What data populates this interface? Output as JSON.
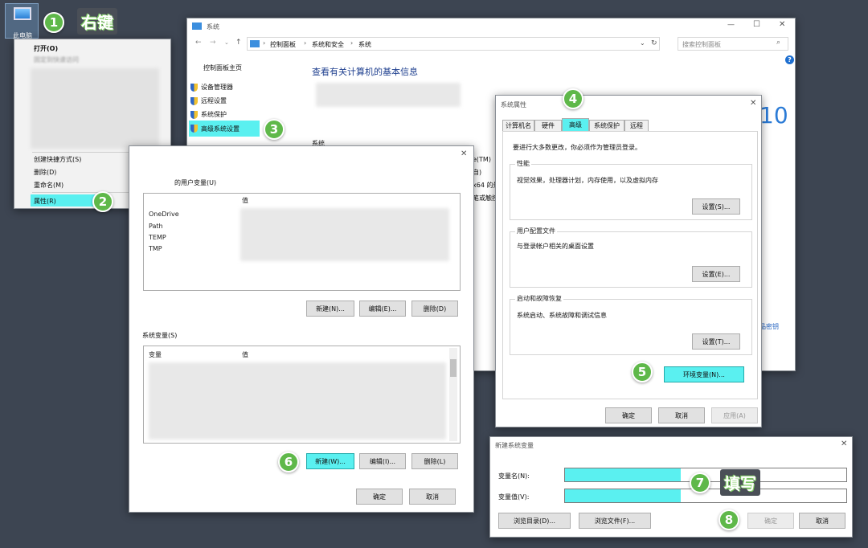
{
  "desktop": {
    "computer_label": "此电脑"
  },
  "annotations": {
    "right_click": "右键",
    "fill_in": "填写",
    "steps": [
      "1",
      "2",
      "3",
      "4",
      "5",
      "6",
      "7",
      "8"
    ]
  },
  "context_menu": {
    "items": [
      "打开(O)",
      "固定到快速访问",
      "创建快捷方式(S)",
      "删除(D)",
      "重命名(M)",
      "属性(R)"
    ]
  },
  "system_window": {
    "title": "系统",
    "breadcrumb": [
      "控制面板",
      "系统和安全",
      "系统"
    ],
    "search_placeholder": "搜索控制面板",
    "sidebar_home": "控制面板主页",
    "sidebar_links": [
      "设备管理器",
      "远程设置",
      "系统保护",
      "高级系统设置"
    ],
    "heading": "查看有关计算机的基本信息",
    "section_system": "系统",
    "partial_text": [
      "e(TM)",
      "自)",
      "x64 的处",
      "笔或触控",
      "品密钥"
    ],
    "win_logo_text": "10",
    "help": "?",
    "controls": [
      "—",
      "☐",
      "✕"
    ]
  },
  "env_dialog": {
    "close": "✕",
    "user_vars_title": "的用户变量(U)",
    "col_value": "值",
    "user_vars": [
      "OneDrive",
      "Path",
      "TEMP",
      "TMP"
    ],
    "user_buttons": [
      "新建(N)...",
      "编辑(E)...",
      "删除(D)"
    ],
    "sys_vars_title": "系统变量(S)",
    "col_var": "变量",
    "sys_buttons": [
      "新建(W)...",
      "编辑(I)...",
      "删除(L)"
    ],
    "ok": "确定",
    "cancel": "取消"
  },
  "sysprop_dialog": {
    "title": "系统属性",
    "close": "✕",
    "tabs": [
      "计算机名",
      "硬件",
      "高级",
      "系统保护",
      "远程"
    ],
    "admin_note": "要进行大多数更改，你必须作为管理员登录。",
    "perf_title": "性能",
    "perf_desc": "视觉效果，处理器计划，内存使用，以及虚拟内存",
    "perf_btn": "设置(S)...",
    "profile_title": "用户配置文件",
    "profile_desc": "与登录帐户相关的桌面设置",
    "profile_btn": "设置(E)...",
    "startup_title": "启动和故障恢复",
    "startup_desc": "系统启动、系统故障和调试信息",
    "startup_btn": "设置(T)...",
    "env_btn": "环境变量(N)...",
    "ok": "确定",
    "cancel": "取消",
    "apply": "应用(A)"
  },
  "new_var_dialog": {
    "title": "新建系统变量",
    "close": "✕",
    "name_label": "变量名(N):",
    "value_label": "变量值(V):",
    "name_value": "",
    "value_value": "",
    "browse_dir": "浏览目录(D)...",
    "browse_file": "浏览文件(F)...",
    "ok": "确定",
    "cancel": "取消"
  },
  "colors": {
    "highlight": "#5af0f0",
    "badge": "#5fb84a",
    "desktop": "#3d4552"
  }
}
